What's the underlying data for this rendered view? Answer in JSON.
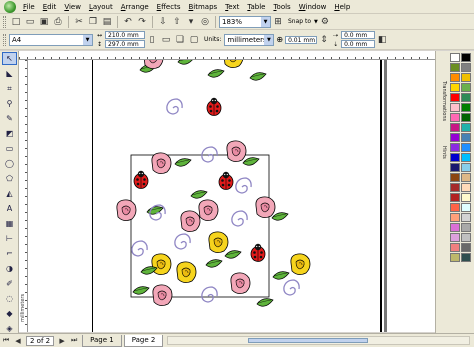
{
  "menu": [
    "File",
    "Edit",
    "View",
    "Layout",
    "Arrange",
    "Effects",
    "Bitmaps",
    "Text",
    "Table",
    "Tools",
    "Window",
    "Help"
  ],
  "toolbar1": {
    "zoom": "183%",
    "snap_to": "Snap to"
  },
  "toolbar2": {
    "page_size": "A4",
    "width": "210.0 mm",
    "height": "297.0 mm",
    "units_label": "Units:",
    "units": "millimeters",
    "nudge": "0.01 mm",
    "dup_x": "0.0 mm",
    "dup_y": "0.0 mm"
  },
  "ruler": {
    "vertical_label": "millimeters"
  },
  "docker": {
    "tab1": "Transformations",
    "tab2": "Hints"
  },
  "status": {
    "page_count": "2 of 2",
    "tabs": [
      "Page 1",
      "Page 2"
    ],
    "active_tab": 1
  },
  "palette_colors": [
    "#ffffff",
    "#000000",
    "#6b8e23",
    "#808080",
    "#ff8c00",
    "#f0c000",
    "#ffd700",
    "#6ab04c",
    "#ff0000",
    "#2e8b57",
    "#ffc0cb",
    "#008000",
    "#ff69b4",
    "#006400",
    "#c71585",
    "#20b2aa",
    "#9400d3",
    "#4682b4",
    "#8a2be2",
    "#1e90ff",
    "#0000cd",
    "#00bfff",
    "#191970",
    "#87ceeb",
    "#8b4513",
    "#deb887",
    "#a52a2a",
    "#ffdab9",
    "#b22222",
    "#fffacd",
    "#ff6347",
    "#e0ffff",
    "#ffa07a",
    "#d3d3d3",
    "#da70d6",
    "#a9a9a9",
    "#dda0dd",
    "#c0c0c0",
    "#f08080",
    "#696969",
    "#bdb76b",
    "#2f4f4f"
  ]
}
